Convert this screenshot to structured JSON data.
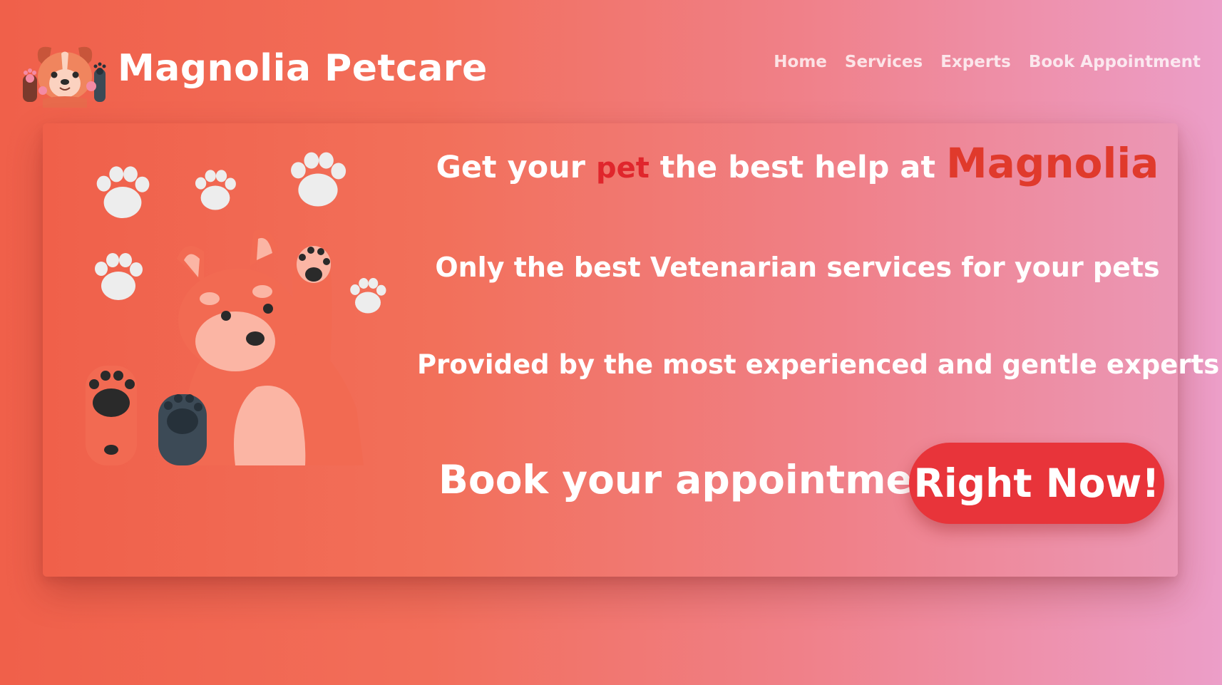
{
  "brand": {
    "name": "Magnolia Petcare",
    "logo_icon": "dog-logo-icon"
  },
  "nav": {
    "items": [
      "Home",
      "Services",
      "Experts",
      "Book Appointment"
    ]
  },
  "hero": {
    "headline_part1": "Get your ",
    "headline_accent": "pet",
    "headline_part2": " the best help at ",
    "headline_brand": "Magnolia",
    "line2": "Only the best Vetenarian services for your pets",
    "line3": "Provided by the most experienced and gentle experts",
    "cta_text": "Book your appointment",
    "cta_button": "Right Now!",
    "illustration_icon": "dog-paws-illustration-icon"
  },
  "colors": {
    "accent": "#e8343a",
    "background_start": "#f0604a",
    "background_end": "#ec9ec8"
  }
}
